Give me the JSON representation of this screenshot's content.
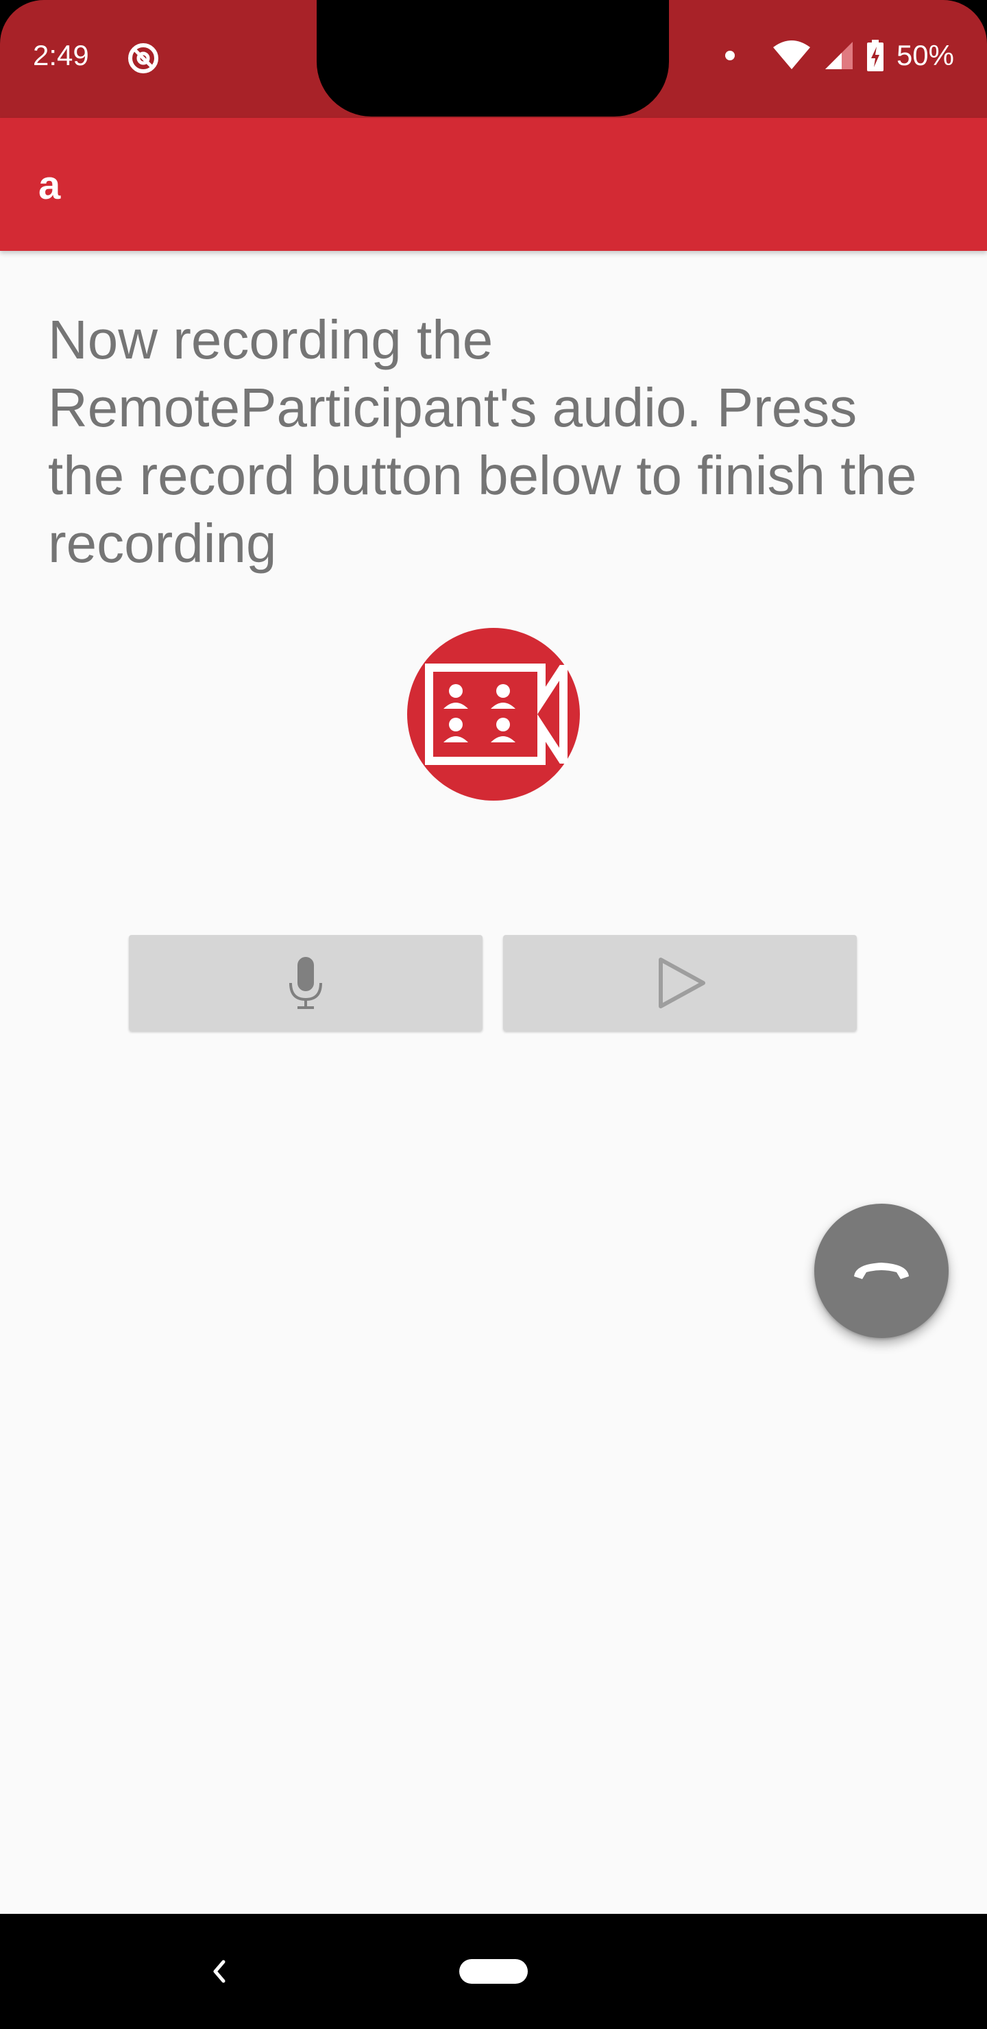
{
  "status_bar": {
    "time": "2:49",
    "battery": "50%",
    "icons": [
      "do-not-disturb-icon",
      "notification-dot-icon",
      "wifi-icon",
      "cell-signal-icon",
      "battery-charging-icon"
    ]
  },
  "app_bar": {
    "title": "a",
    "color": "#d32a34"
  },
  "main": {
    "instruction": "Now recording the RemoteParticipant's audio. Press the record button below to finish the recording",
    "video_icon": "video-conference-icon",
    "buttons": [
      {
        "name": "record",
        "icon": "microphone-icon"
      },
      {
        "name": "play",
        "icon": "play-icon"
      }
    ],
    "fab_icon": "hang-up-icon"
  },
  "colors": {
    "accent": "#d32a34",
    "status_bar": "#a82228",
    "text": "#757575",
    "button_bg": "#d6d6d6",
    "fab": "#797979"
  },
  "nav_bar": {
    "icons": [
      "back-icon",
      "home-pill-icon"
    ]
  }
}
